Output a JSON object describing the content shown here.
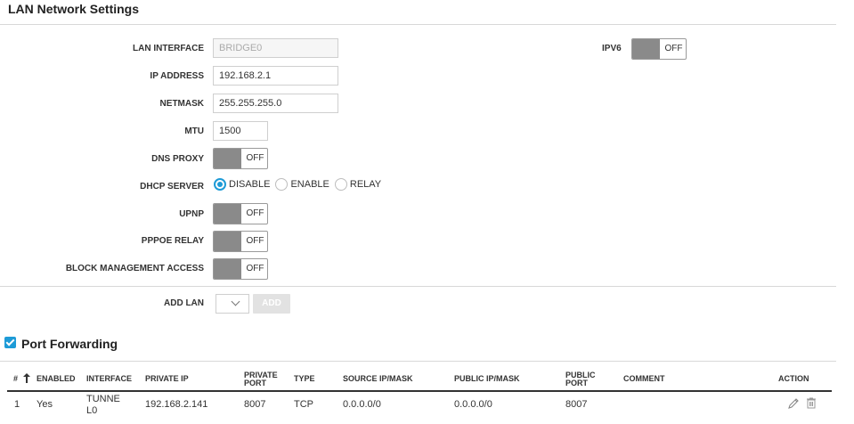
{
  "lan": {
    "title": "LAN Network Settings",
    "interface": {
      "label": "LAN INTERFACE",
      "value": "BRIDGE0"
    },
    "ip_address": {
      "label": "IP ADDRESS",
      "value": "192.168.2.1"
    },
    "netmask": {
      "label": "NETMASK",
      "value": "255.255.255.0"
    },
    "mtu": {
      "label": "MTU",
      "value": "1500"
    },
    "dns_proxy": {
      "label": "DNS PROXY",
      "state": "OFF"
    },
    "dhcp_server": {
      "label": "DHCP SERVER",
      "options": [
        "DISABLE",
        "ENABLE",
        "RELAY"
      ],
      "selected": "DISABLE"
    },
    "upnp": {
      "label": "UPNP",
      "state": "OFF"
    },
    "pppoe_relay": {
      "label": "PPPOE RELAY",
      "state": "OFF"
    },
    "block_management": {
      "label": "BLOCK MANAGEMENT ACCESS",
      "state": "OFF"
    },
    "ipv6": {
      "label": "IPV6",
      "state": "OFF"
    },
    "add_lan": {
      "label": "ADD LAN",
      "button": "ADD"
    }
  },
  "port_forwarding": {
    "title": "Port Forwarding",
    "checked": true,
    "columns": {
      "num": "#",
      "enabled": "ENABLED",
      "interface": "INTERFACE",
      "private_ip": "PRIVATE IP",
      "private_port_1": "PRIVATE",
      "private_port_2": "PORT",
      "type": "TYPE",
      "source": "SOURCE IP/MASK",
      "public_ip": "PUBLIC IP/MASK",
      "public_port_1": "PUBLIC",
      "public_port_2": "PORT",
      "comment": "COMMENT",
      "action": "ACTION"
    },
    "rows": [
      {
        "num": "1",
        "enabled": "Yes",
        "interface_1": "TUNNE",
        "interface_2": "L0",
        "private_ip": "192.168.2.141",
        "private_port": "8007",
        "type": "TCP",
        "source": "0.0.0.0/0",
        "public_ip": "0.0.0.0/0",
        "public_port": "8007",
        "comment": ""
      }
    ]
  },
  "colors": {
    "accent": "#1e9bd7",
    "toggle_knob": "#8a8a8a"
  },
  "icons": {
    "sort": "sort-up-arrow-icon",
    "edit": "pencil-icon",
    "delete": "trash-icon"
  }
}
